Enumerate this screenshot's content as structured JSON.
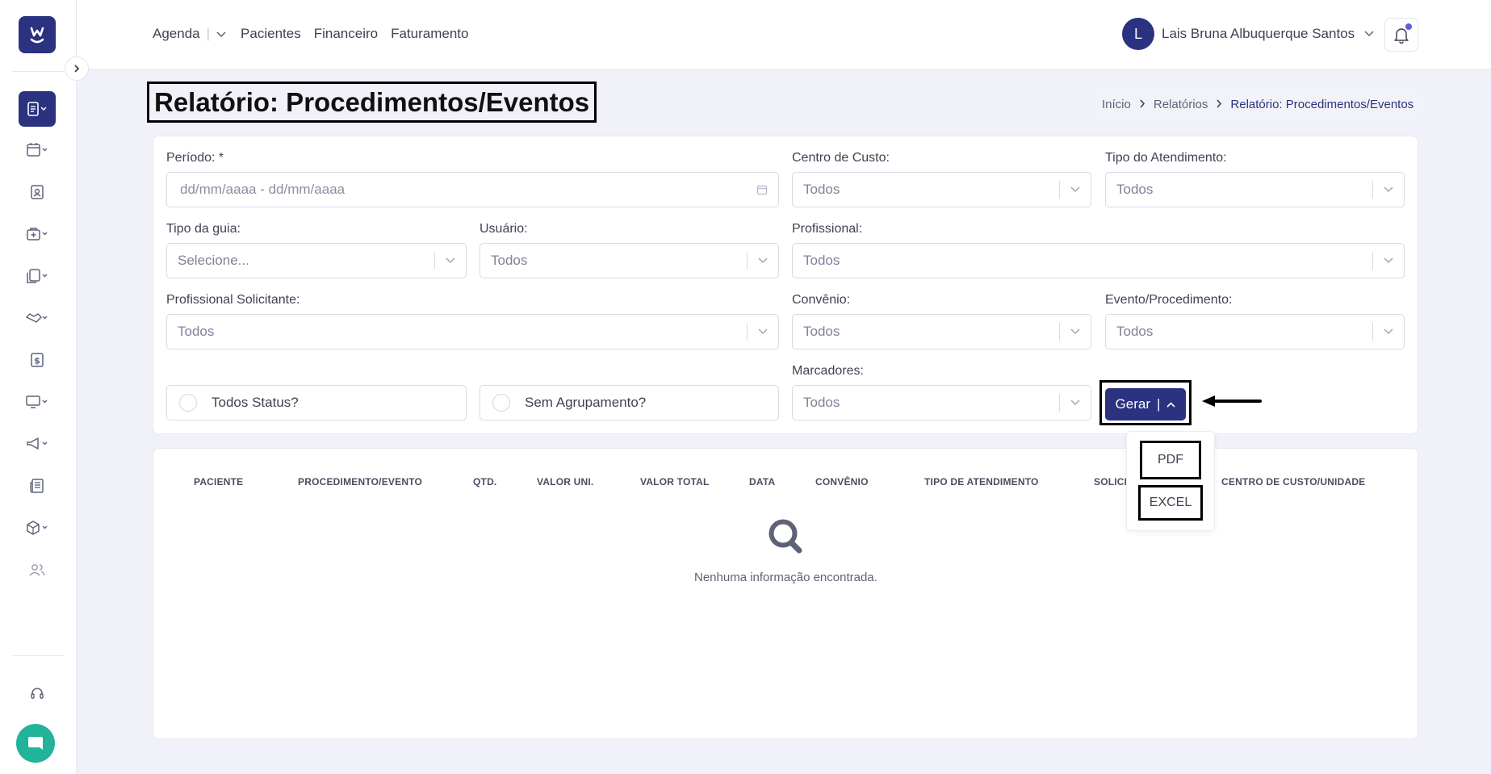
{
  "topbar": {
    "nav": [
      "Agenda",
      "Pacientes",
      "Financeiro",
      "Faturamento"
    ],
    "user_initial": "L",
    "user_name": "Lais Bruna Albuquerque Santos"
  },
  "page": {
    "title": "Relatório: Procedimentos/Eventos",
    "breadcrumb": [
      "Início",
      "Relatórios",
      "Relatório: Procedimentos/Eventos"
    ]
  },
  "filters": {
    "periodo_label": "Período: *",
    "periodo_placeholder": "dd/mm/aaaa - dd/mm/aaaa",
    "centro_custo_label": "Centro de Custo:",
    "centro_custo_value": "Todos",
    "tipo_atendimento_label": "Tipo do Atendimento:",
    "tipo_atendimento_value": "Todos",
    "tipo_guia_label": "Tipo da guia:",
    "tipo_guia_value": "Selecione...",
    "usuario_label": "Usuário:",
    "usuario_value": "Todos",
    "profissional_label": "Profissional:",
    "profissional_value": "Todos",
    "prof_solicitante_label": "Profissional Solicitante:",
    "prof_solicitante_value": "Todos",
    "convenio_label": "Convênio:",
    "convenio_value": "Todos",
    "evento_label": "Evento/Procedimento:",
    "evento_value": "Todos",
    "marcadores_label": "Marcadores:",
    "marcadores_value": "Todos",
    "todos_status_label": "Todos Status?",
    "sem_agrupamento_label": "Sem Agrupamento?"
  },
  "actions": {
    "gerar_label": "Gerar",
    "gerar_separator": "|",
    "menu_items": [
      "PDF",
      "EXCEL"
    ]
  },
  "table": {
    "columns": [
      "PACIENTE",
      "PROCEDIMENTO/EVENTO",
      "QTD.",
      "VALOR UNI.",
      "VALOR TOTAL",
      "DATA",
      "CONVÊNIO",
      "TIPO DE ATENDIMENTO",
      "SOLICI",
      "CENTRO DE CUSTO/UNIDADE"
    ],
    "empty_message": "Nenhuma informação encontrada."
  },
  "colors": {
    "primary": "#2b3280",
    "chat": "#22b39b",
    "background": "#f0f1f9"
  },
  "icons": {
    "sidebar": [
      "reports-icon",
      "calendar-icon",
      "patient-card-icon",
      "medical-bag-icon",
      "documents-icon",
      "handshake-icon",
      "dollar-icon",
      "monitor-icon",
      "megaphone-icon",
      "newspaper-icon",
      "box-icon",
      "users-icon",
      "headset-icon",
      "chat-icon"
    ]
  }
}
